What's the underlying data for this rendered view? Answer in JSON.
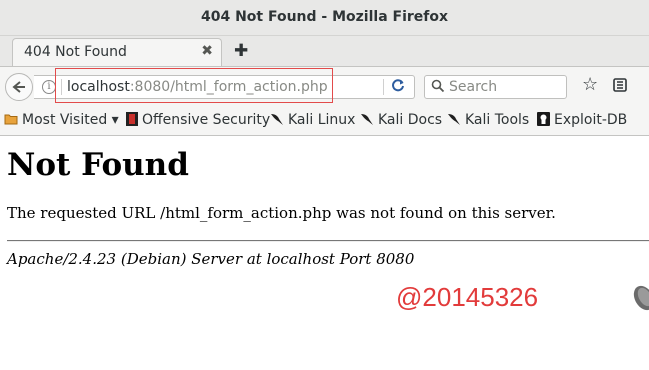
{
  "window": {
    "title": "404 Not Found - Mozilla Firefox"
  },
  "tab": {
    "label": "404 Not Found",
    "close_glyph": "✖",
    "new_tab_glyph": "✚"
  },
  "navbar": {
    "url_host": "localhost",
    "url_rest": ":8080/html_form_action.php",
    "search_placeholder": "Search"
  },
  "bookmarks": [
    {
      "label": "Most Visited ▾",
      "icon": "folder-icon"
    },
    {
      "label": "Offensive Security",
      "icon": "offsec-icon"
    },
    {
      "label": "Kali Linux",
      "icon": "kali-dragon-icon"
    },
    {
      "label": "Kali Docs",
      "icon": "kali-dragon-icon"
    },
    {
      "label": "Kali Tools",
      "icon": "kali-dragon-icon"
    },
    {
      "label": "Exploit-DB",
      "icon": "exploitdb-icon"
    }
  ],
  "page": {
    "heading": "Not Found",
    "message": "The requested URL /html_form_action.php was not found on this server.",
    "address": "Apache/2.4.23 (Debian) Server at localhost Port 8080",
    "watermark": "@20145326"
  },
  "colors": {
    "highlight": "#e24b4b",
    "watermark": "#e23b3b",
    "reload": "#2e5d9f"
  }
}
